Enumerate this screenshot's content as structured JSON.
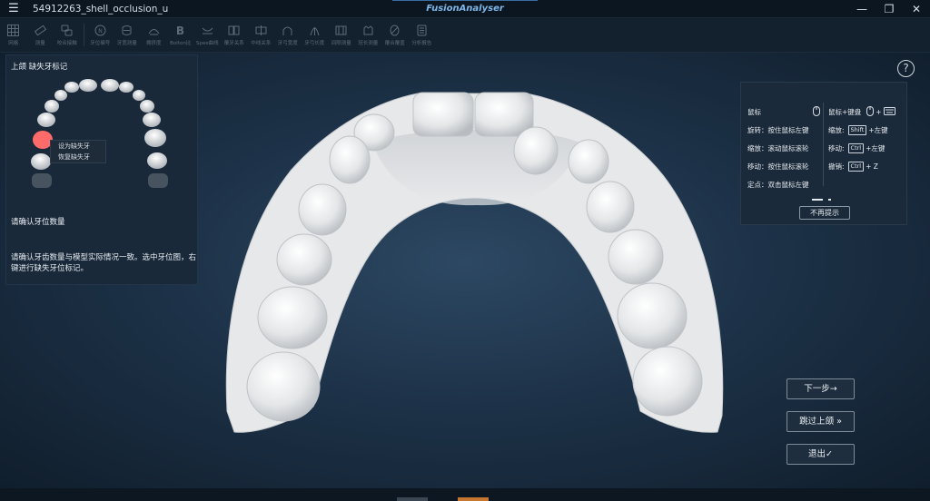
{
  "titlebar": {
    "menu_icon": "hamburger-icon",
    "filename": "54912263_shell_occlusion_u",
    "app_title": "FusionAnalyser",
    "controls": [
      "minimize-icon",
      "restore-icon",
      "close-icon"
    ]
  },
  "toolbar": {
    "tools": [
      {
        "label": "网格",
        "icon": "grid-icon"
      },
      {
        "label": "测量",
        "icon": "ruler-icon"
      },
      {
        "label": "咬合接触",
        "icon": "occlusion-icon"
      },
      {
        "label": "牙位编号",
        "icon": "tooth-number-icon"
      },
      {
        "label": "牙宽测量",
        "icon": "tooth-width-icon"
      },
      {
        "label": "拥挤度",
        "icon": "crowding-icon"
      },
      {
        "label": "Bolton比",
        "icon": "bolton-icon"
      },
      {
        "label": "Spee曲线",
        "icon": "spee-curve-icon"
      },
      {
        "label": "覆牙关系",
        "icon": "overbite-icon"
      },
      {
        "label": "中线关系",
        "icon": "midline-icon"
      },
      {
        "label": "牙弓宽度",
        "icon": "arch-width-icon"
      },
      {
        "label": "牙弓长度",
        "icon": "arch-length-icon"
      },
      {
        "label": "间隙测量",
        "icon": "gap-measure-icon"
      },
      {
        "label": "冠长测量",
        "icon": "crown-length-icon"
      },
      {
        "label": "覆合覆盖",
        "icon": "overjet-icon"
      },
      {
        "label": "分析报告",
        "icon": "report-icon"
      }
    ]
  },
  "left_panel": {
    "title": "上颌 缺失牙标记",
    "context_menu": [
      "设为缺失牙",
      "恢复缺失牙"
    ],
    "heading": "请确认牙位数量",
    "body": "请确认牙齿数量与模型实际情况一致。选中牙位图，右键进行缺失牙位标记。"
  },
  "help": {
    "icon": "question-icon",
    "mouse_title": "鼠标",
    "mouse_rows": [
      "旋转：按住鼠标左键",
      "缩放：滚动鼠标滚轮",
      "移动：按住鼠标滚轮",
      "定点：双击鼠标左键"
    ],
    "kb_title": "鼠标+键盘",
    "kb_rows": [
      {
        "label": "缩放:",
        "key": "Shift",
        "suffix": "+左键"
      },
      {
        "label": "移动:",
        "key": "Ctrl",
        "suffix": "+左键"
      },
      {
        "label": "撤销:",
        "key": "Ctrl",
        "suffix": "+ Z"
      }
    ],
    "dismiss_label": "不再提示"
  },
  "actions": {
    "next_label": "下一步→",
    "skip_label": "跳过上颌 »",
    "exit_label": "退出✓"
  },
  "colors": {
    "missing_tooth": "#ff6b6b",
    "accent": "#7fb6e8",
    "panel": "#19293a"
  }
}
